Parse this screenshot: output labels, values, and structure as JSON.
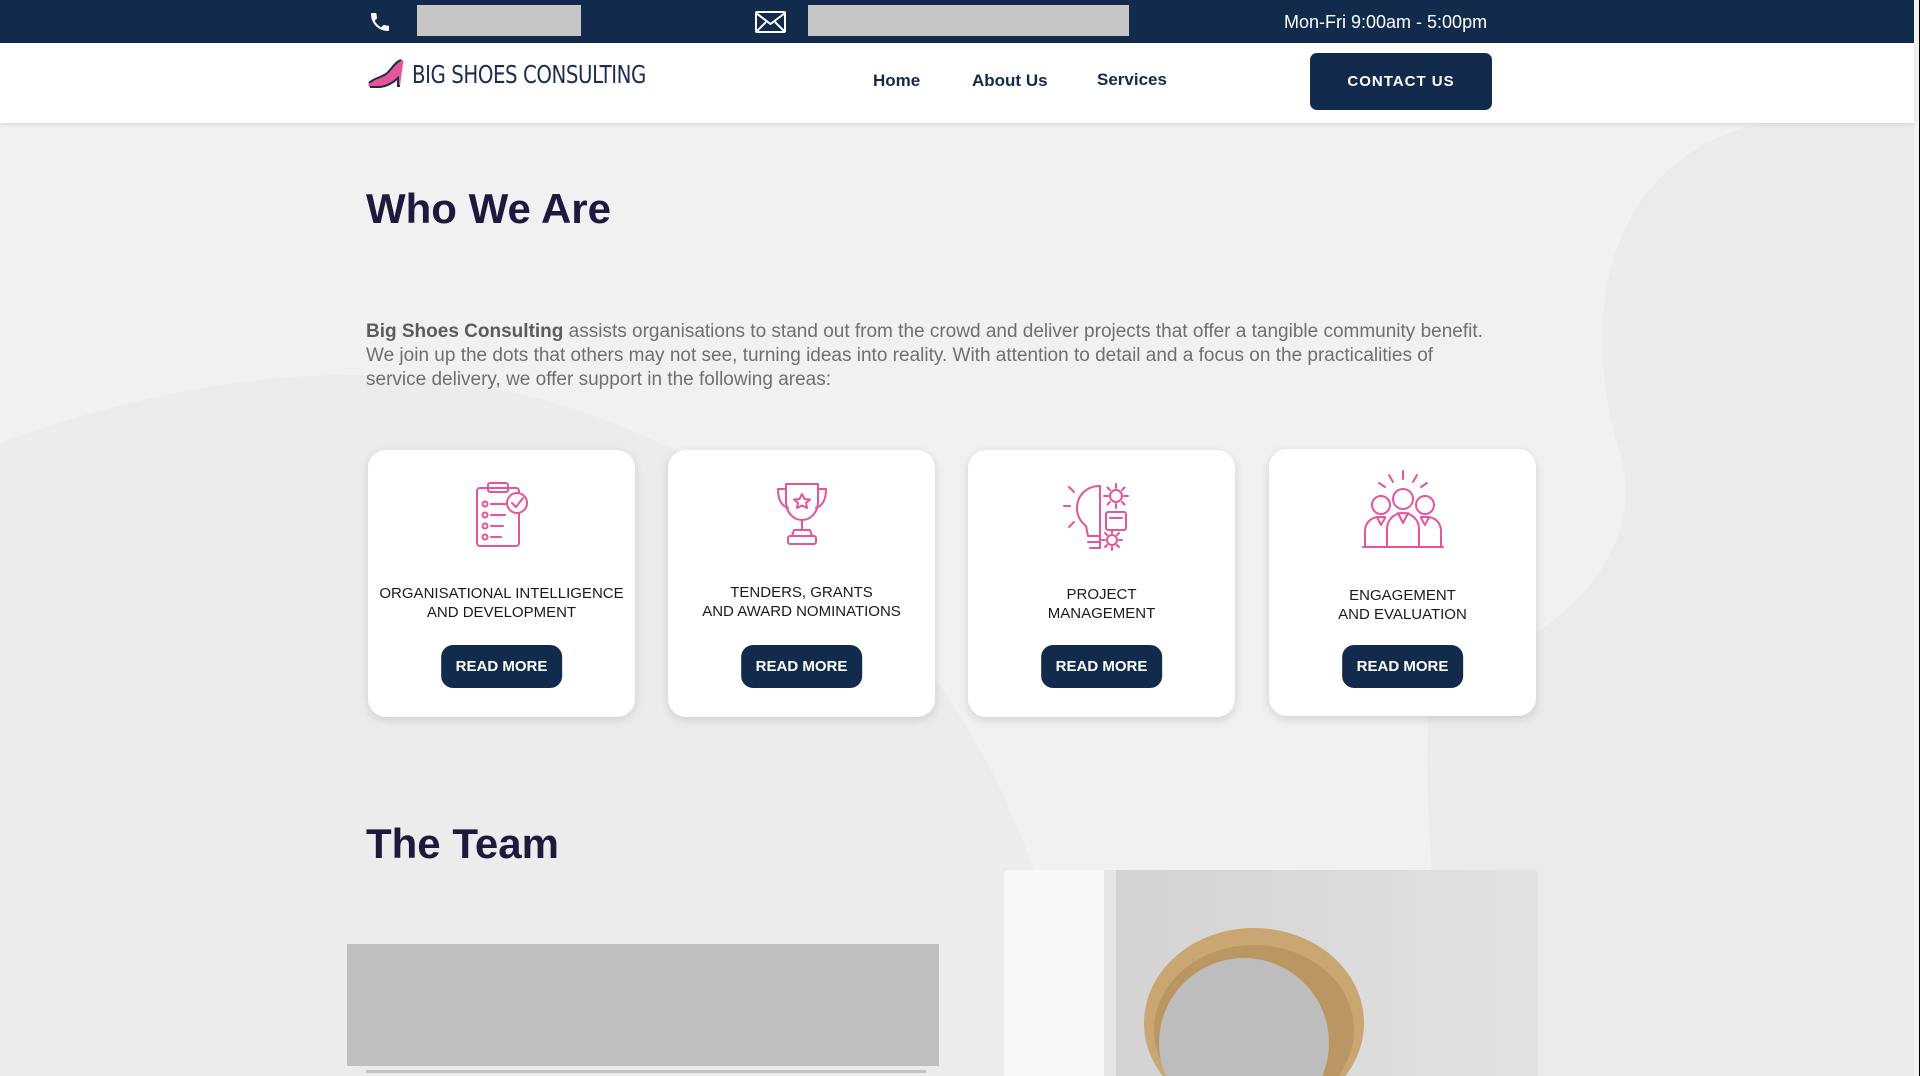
{
  "topbar": {
    "phone_icon": "phone-icon",
    "email_icon": "envelope-icon",
    "hours": "Mon-Fri 9:00am - 5:00pm"
  },
  "header": {
    "logo_text": "BIG SHOES CONSULTING",
    "logo_icon": "high-heel-shoe-icon",
    "nav": [
      "Home",
      "About Us",
      "Services"
    ],
    "contact_label": "CONTACT US"
  },
  "who": {
    "title": "Who We Are",
    "intro_bold": "Big Shoes Consulting",
    "intro_rest": " assists organisations to stand out from the crowd and deliver projects that offer a tangible community benefit. We join up the dots that others may not see, turning ideas into reality. With attention to detail and a focus on the practicalities of service delivery, we offer support in the following areas:"
  },
  "services": [
    {
      "title": "ORGANISATIONAL INTELLIGENCE\nAND DEVELOPMENT",
      "icon": "clipboard-checklist-icon",
      "button": "READ MORE"
    },
    {
      "title": "TENDERS, GRANTS\nAND AWARD NOMINATIONS",
      "icon": "trophy-icon",
      "button": "READ MORE"
    },
    {
      "title": "PROJECT\nMANAGEMENT",
      "icon": "lightbulb-gears-icon",
      "button": "READ MORE"
    },
    {
      "title": "ENGAGEMENT\nAND EVALUATION",
      "icon": "team-group-icon",
      "button": "READ MORE"
    }
  ],
  "team": {
    "title": "The Team"
  },
  "colors": {
    "navy": "#122b4c",
    "accent_pink": "#e4559a",
    "heading": "#1f1a3d",
    "background": "#f0f1f1"
  }
}
